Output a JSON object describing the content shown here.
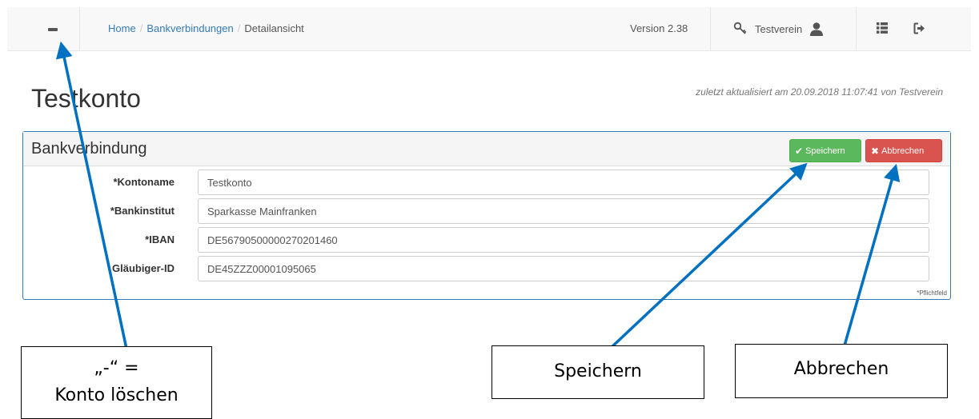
{
  "navbar": {
    "breadcrumb": [
      {
        "label": "Home"
      },
      {
        "label": "Bankverbindungen"
      },
      {
        "label": "Detailansicht"
      }
    ],
    "version": "Version 2.38",
    "user_name": "Testverein",
    "icons": [
      "minus-icon",
      "key-icon",
      "user-icon",
      "list-icon",
      "logout-icon"
    ]
  },
  "page": {
    "title": "Testkonto",
    "last_updated": "zuletzt aktualisiert am 20.09.2018 11:07:41 von Testverein"
  },
  "panel": {
    "title": "Bankverbindung",
    "save_label": "Speichern",
    "cancel_label": "Abbrechen",
    "fields": [
      {
        "label": "*Kontoname",
        "value": "Testkonto"
      },
      {
        "label": "*Bankinstitut",
        "value": "Sparkasse Mainfranken"
      },
      {
        "label": "*IBAN",
        "value": "DE56790500000270201460"
      },
      {
        "label": "Gläubiger-ID",
        "value": "DE45ZZZ00001095065"
      }
    ],
    "required_note": "*Pflichtfeld"
  },
  "annotations": {
    "delete_line1": "„-“ =",
    "delete_line2": "Konto löschen",
    "save": "Speichern",
    "cancel": "Abbrechen"
  },
  "colors": {
    "link": "#337ab7",
    "panel_border": "#337ab7",
    "save_button": "#5cb85c",
    "cancel_button": "#d9534f",
    "arrow": "#0070c0"
  }
}
